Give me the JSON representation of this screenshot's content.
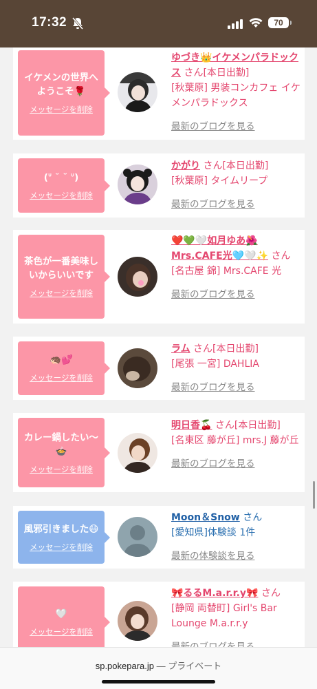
{
  "status": {
    "time": "17:32",
    "battery": "70"
  },
  "browser": {
    "url": "sp.pokepara.jp",
    "separator": "—",
    "mode": "プライベート"
  },
  "common": {
    "delete_label": "メッセージを削除",
    "san": "さん"
  },
  "cards": [
    {
      "msg": "イケメンの世界へようこそ🌹",
      "name": "ゆづき👑イケメンパラドックス",
      "status": "[本日出勤]",
      "location": "[秋葉原] 男装コンカフェ イケメンパラドックス",
      "link": "最新のブログを見る"
    },
    {
      "msg": "(ᐡ ˘ ˘ ᐡ)",
      "name": "かがり",
      "status": "[本日出勤]",
      "location": "[秋葉原] タイムリープ",
      "link": "最新のブログを見る"
    },
    {
      "msg": "茶色が一番美味しいからいいです",
      "name": "❤️💚🤍如月ゆあ🌺Mrs.CAFE光🩵🤍✨",
      "status": "",
      "location": "[名古屋 錦] Mrs.CAFE 光",
      "link": "最新のブログを見る"
    },
    {
      "msg": "🦔💕",
      "name": "ラム",
      "status": "[本日出勤]",
      "location": "[尾張 一宮] DAHLIA",
      "link": "最新のブログを見る"
    },
    {
      "msg": "カレー鍋したい〜🍲",
      "name": "明日香🍒",
      "status": "[本日出勤]",
      "location": "[名東区 藤が丘] mrs.J 藤が丘",
      "link": "最新のブログを見る"
    },
    {
      "msg": "風邪引きました😷",
      "name": "Moon＆Snow",
      "status": "",
      "location": "[愛知県]体験談 1件",
      "link": "最新の体験談を見る"
    },
    {
      "msg": "🤍",
      "name": "🎀るるM.a.r.r.y🎀",
      "status": "",
      "location": "[静岡 両替町] Girl's Bar Lounge M.a.r.r.y",
      "link": "最新のブログを見る"
    }
  ],
  "colors": {
    "accent": "#e4466e",
    "bubble_pink": "#fc96a7",
    "bubble_blue": "#8db4ec",
    "blue_text": "#1f5fa5",
    "statusbar": "#584536"
  }
}
